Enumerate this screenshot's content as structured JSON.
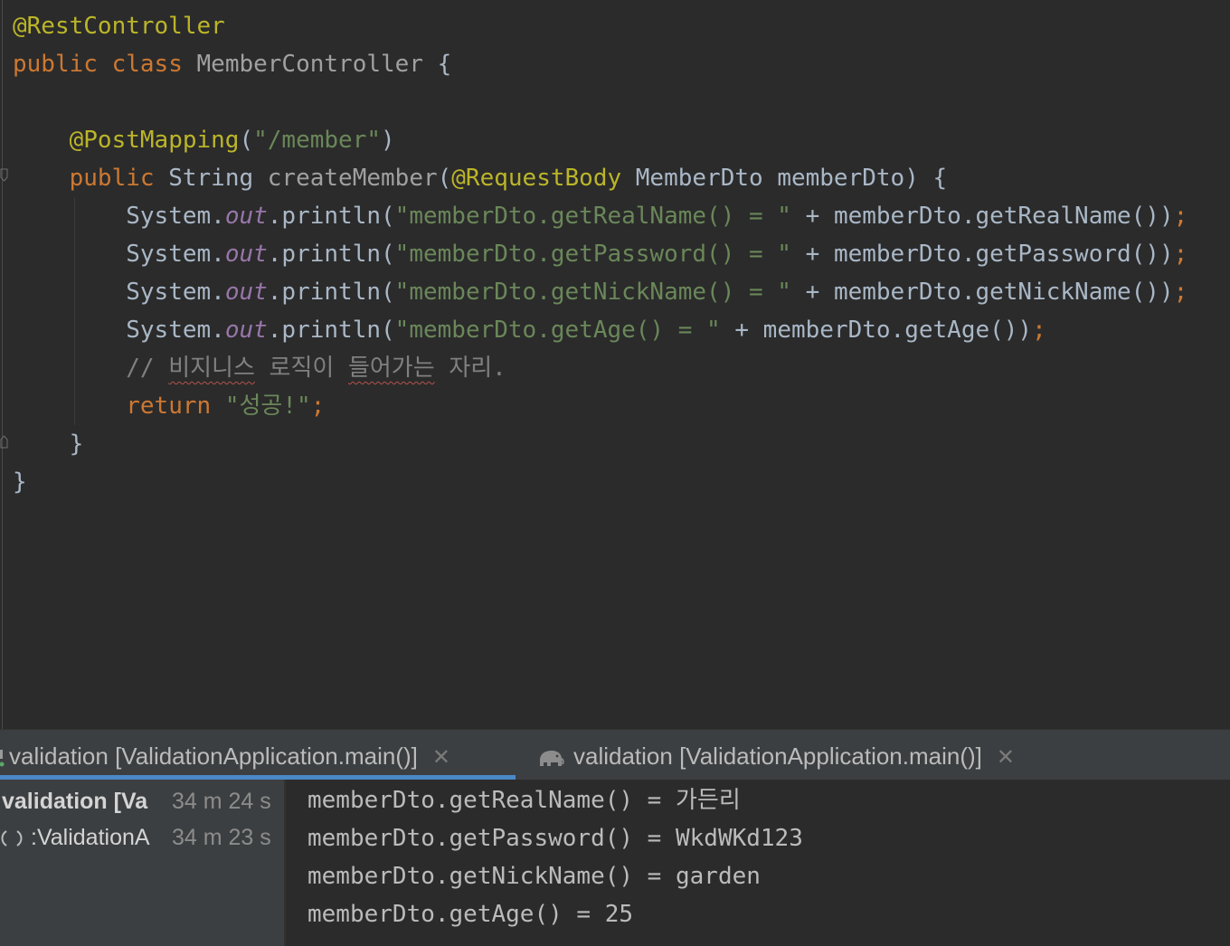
{
  "editor": {
    "line1_annotation": "@RestController",
    "line2_kw1": "public",
    "line2_kw2": "class",
    "line2_class": "MemberController",
    "line2_brace": "{",
    "line4_annotation": "@PostMapping",
    "line4_lparen": "(",
    "line4_str": "\"/member\"",
    "line4_rparen": ")",
    "line5_kw": "public",
    "line5_type": "String",
    "line5_method": "createMember",
    "line5_lparen": "(",
    "line5_annotation": "@RequestBody",
    "line5_params": "MemberDto memberDto) {",
    "print_prefix": "System.",
    "print_field": "out",
    "print_call": ".println(",
    "plus": " + ",
    "line6_str": "\"memberDto.getRealName() = \"",
    "line6_expr": "memberDto.getRealName())",
    "line7_str": "\"memberDto.getPassword() = \"",
    "line7_expr": "memberDto.getPassword())",
    "line8_str": "\"memberDto.getNickName() = \"",
    "line8_expr": "memberDto.getNickName())",
    "line9_str": "\"memberDto.getAge() = \"",
    "line9_expr": "memberDto.getAge())",
    "semicolon": ";",
    "comment_prefix": "// ",
    "comment_w1": "비지니스",
    "comment_w2": "로직이",
    "comment_w3": "들어가는",
    "comment_w4": "자리.",
    "return_kw": "return",
    "return_str": "\"성공!\"",
    "close_method": "}",
    "close_class": "}"
  },
  "run_panel": {
    "tabs": [
      {
        "label": "validation [ValidationApplication.main()]",
        "active": true
      },
      {
        "label": "validation [ValidationApplication.main()]",
        "active": false
      }
    ],
    "close_glyph": "✕",
    "tree": [
      {
        "name": "validation [Va",
        "time": "34 m 24 s"
      },
      {
        "name": ":ValidationA",
        "time": "34 m 23 s"
      }
    ],
    "console_lines": [
      "memberDto.getRealName() = 가든리",
      "memberDto.getPassword() = WkdWKd123",
      "memberDto.getNickName() = garden",
      "memberDto.getAge() = 25"
    ]
  },
  "colors": {
    "background": "#2b2b2b",
    "keyword": "#cc7832",
    "annotation": "#bbb529",
    "string": "#6a8759",
    "static_field": "#9876aa",
    "comment": "#808080",
    "tab_accent": "#4a88c7"
  },
  "icons": [
    "fold-marker-icon",
    "tab-close-icon",
    "elephant-icon",
    "run-indicator-icon",
    "spinner-icon"
  ]
}
